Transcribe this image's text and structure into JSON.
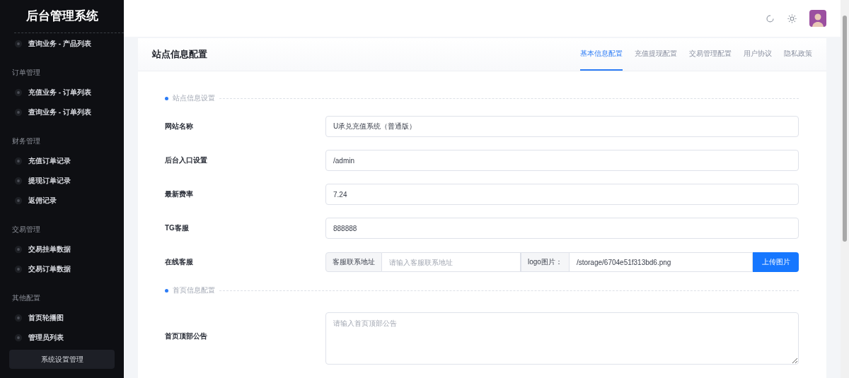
{
  "sidebar": {
    "title": "后台管理系统",
    "groups": [
      {
        "items": [
          {
            "label": "查询业务 - 产品列表"
          }
        ]
      },
      {
        "heading": "订单管理",
        "items": [
          {
            "label": "充值业务 - 订单列表"
          },
          {
            "label": "查询业务 - 订单列表"
          }
        ]
      },
      {
        "heading": "财务管理",
        "items": [
          {
            "label": "充值订单记录"
          },
          {
            "label": "提现订单记录"
          },
          {
            "label": "返佣记录"
          }
        ]
      },
      {
        "heading": "交易管理",
        "items": [
          {
            "label": "交易挂单数据"
          },
          {
            "label": "交易订单数据"
          }
        ]
      },
      {
        "heading": "其他配置",
        "items": [
          {
            "label": "首页轮播图"
          },
          {
            "label": "管理员列表"
          }
        ]
      }
    ],
    "bottom_button": "系统设置管理"
  },
  "card": {
    "title": "站点信息配置",
    "tabs": [
      {
        "label": "基本信息配置",
        "selected": true
      },
      {
        "label": "充值提现配置",
        "selected": false
      },
      {
        "label": "交易管理配置",
        "selected": false
      },
      {
        "label": "用户协议",
        "selected": false
      },
      {
        "label": "隐私政策",
        "selected": false
      }
    ],
    "sections": [
      {
        "title": "站点信息设置",
        "rows": [
          {
            "kind": "text",
            "label": "网站名称",
            "value": "U承兑充值系统（普通版）"
          },
          {
            "kind": "text",
            "label": "后台入口设置",
            "value": "/admin"
          },
          {
            "kind": "text",
            "label": "最新费率",
            "value": "7.24"
          },
          {
            "kind": "text",
            "label": "TG客服",
            "value": "888888"
          },
          {
            "kind": "combo",
            "label": "在线客服",
            "prefix": "客服联系地址",
            "placeholder": "请输入客服联系地址",
            "prefix2": "logo图片：",
            "value": "/storage/6704e51f313bd6.png",
            "button": "上传图片"
          }
        ]
      },
      {
        "title": "首页信息配置",
        "rows": [
          {
            "kind": "textarea",
            "label": "首页顶部公告",
            "placeholder": "请输入首页顶部公告"
          },
          {
            "kind": "cut"
          }
        ]
      }
    ]
  }
}
